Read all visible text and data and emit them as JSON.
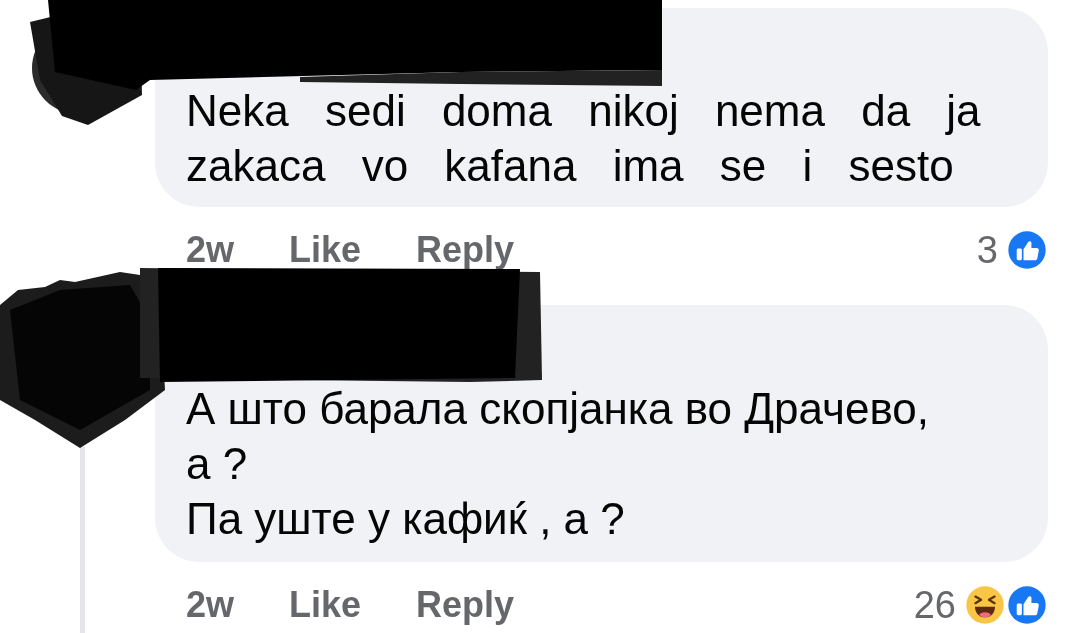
{
  "comments": [
    {
      "redacted": true,
      "text": "Neka sedi doma nikoj nema da ja zakaca vo kafana ima se i sesto",
      "time": "2w",
      "actions": [
        "Like",
        "Reply"
      ],
      "reaction_count": "3",
      "reactions": [
        {
          "kind": "like"
        }
      ]
    },
    {
      "redacted": true,
      "text": "А што барала скопјанка во Драчево,\nа ?\nПа уште у кафиќ , а ?",
      "time": "2w",
      "actions": [
        "Like",
        "Reply"
      ],
      "reaction_count": "26",
      "reactions": [
        {
          "kind": "haha"
        },
        {
          "kind": "like"
        }
      ],
      "has_replies": true
    }
  ]
}
